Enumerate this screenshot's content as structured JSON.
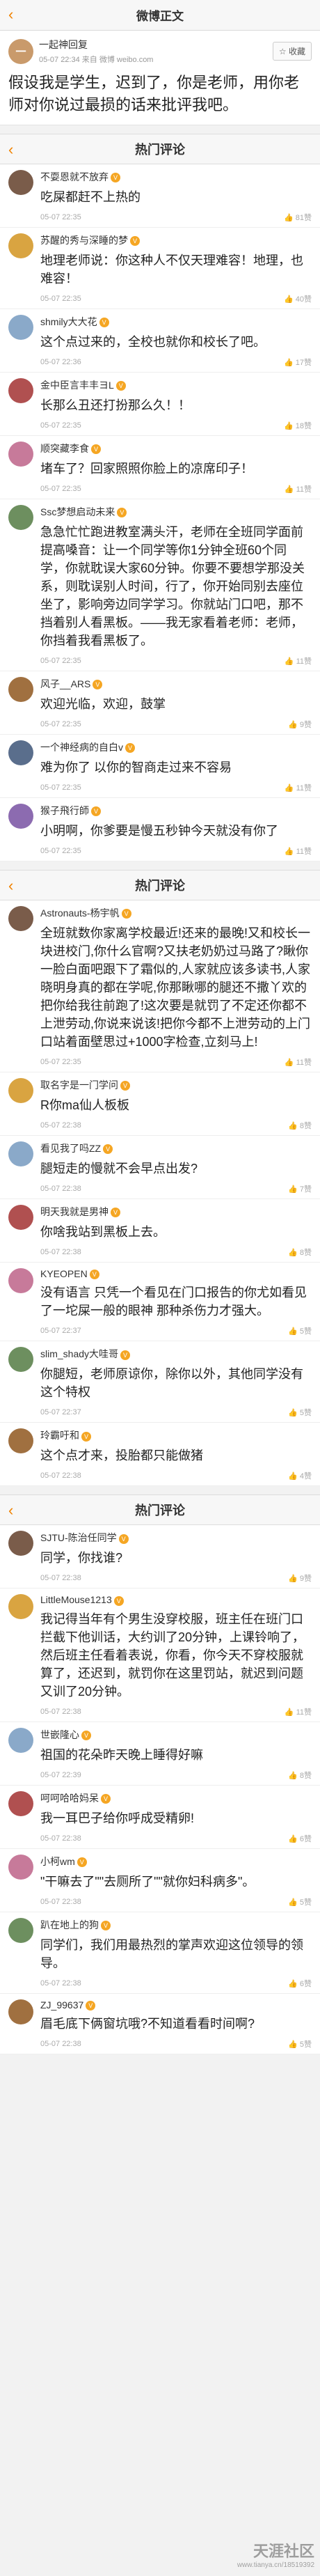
{
  "topbar": {
    "title": "微博正文",
    "back_icon": "chevron-left-icon"
  },
  "post": {
    "author": "一起神回复",
    "time": "05-07 22:34",
    "source": "来自 微博 weibo.com",
    "follow_label": "收藏",
    "text": "假设我是学生，迟到了，你是老师，用你老师对你说过最损的话来批评我吧。"
  },
  "sections": [
    {
      "title": "热门评论"
    },
    {
      "title": "热门评论"
    },
    {
      "title": "热门评论"
    }
  ],
  "comments_1": [
    {
      "name": "不耍恩就不放弃",
      "text": "吃屎都赶不上热的",
      "time": "05-07 22:35",
      "likes": "81赞"
    },
    {
      "name": "苏醒的秀与深睡的梦",
      "text": "地理老师说：你这种人不仅天理难容！地理，也难容！",
      "time": "05-07 22:35",
      "likes": "40赞"
    },
    {
      "name": "shmily大大花",
      "text": "这个点过来的，全校也就你和校长了吧。",
      "time": "05-07 22:36",
      "likes": "17赞"
    },
    {
      "name": "金中臣言丰丰ヨL",
      "text": "长那么丑还打扮那么久！！",
      "time": "05-07 22:35",
      "likes": "18赞"
    },
    {
      "name": "顺突藏李食",
      "text": "堵车了？回家照照你脸上的凉席印子！",
      "time": "05-07 22:35",
      "likes": "11赞"
    },
    {
      "name": "Ssc梦想启动未来",
      "text": "急急忙忙跑进教室满头汗，老师在全班同学面前提高嗓音：让一个同学等你1分钟全班60个同学，你就耽误大家60分钟。你要不要想学那没关系，则耽误别人时间，行了，你开始同别去座位坐了，影响旁边同学学习。你就站门口吧，那不挡着别人看黑板。——我无家看着老师：老师，你挡着我看黑板了。",
      "time": "05-07 22:35",
      "likes": "11赞"
    },
    {
      "name": "风子__ARS",
      "text": "欢迎光临，欢迎，鼓掌",
      "time": "05-07 22:35",
      "likes": "9赞"
    },
    {
      "name": "一个神经病的自白v",
      "text": "难为你了 以你的智商走过来不容易",
      "time": "05-07 22:35",
      "likes": "11赞"
    },
    {
      "name": "猴子飛行師",
      "text": "小明啊，你爹要是慢五秒钟今天就没有你了",
      "time": "05-07 22:35",
      "likes": "11赞"
    }
  ],
  "comments_2": [
    {
      "name": "Astronauts-杨宇帆",
      "text": "全班就数你家离学校最近!还来的最晚!又和校长一块进校门,你什么官啊?又扶老奶奶过马路了?瞅你一脸白面吧跟下了霜似的,人家就应该多读书,人家晓明身真的都在学呢,你那瞅哪的腿还不撒丫欢的把你给我往前跑了!这次要是就罚了不定还你都不上泄劳动,你说来说该!把你今都不上泄劳动的上门口站着面壁思过+1000字检查,立刻马上!",
      "time": "05-07 22:35",
      "likes": "11赞"
    },
    {
      "name": "取名字是一门学问",
      "text": "R你ma仙人板板",
      "time": "05-07 22:38",
      "likes": "8赞"
    },
    {
      "name": "看见我了吗ZZ",
      "text": "腿短走的慢就不会早点出发?",
      "time": "05-07 22:38",
      "likes": "7赞"
    },
    {
      "name": "明天我就是男神",
      "text": "你啥我站到黑板上去。",
      "time": "05-07 22:38",
      "likes": "8赞"
    },
    {
      "name": "KYEOPEN",
      "text": "没有语言 只凭一个看见在门口报告的你尤如看见了一坨屎一般的眼神 那种杀伤力才强大。",
      "time": "05-07 22:37",
      "likes": "5赞"
    },
    {
      "name": "slim_shady大哇哥",
      "text": "你腿短，老师原谅你，除你以外，其他同学没有这个特权",
      "time": "05-07 22:37",
      "likes": "5赞"
    },
    {
      "name": "玲霸吁和",
      "text": "这个点才来，投胎都只能做猪",
      "time": "05-07 22:38",
      "likes": "4赞"
    }
  ],
  "comments_3": [
    {
      "name": "SJTU-陈治任同学",
      "text": "同学，你找谁?",
      "time": "05-07 22:38",
      "likes": "9赞"
    },
    {
      "name": "LittleMouse1213",
      "text": "我记得当年有个男生没穿校服，班主任在班门口拦截下他训话，大约训了20分钟，上课铃响了，然后班主任看着表说，你看，你今天不穿校服就算了，还迟到，就罚你在这里罚站，就迟到问题又训了20分钟。",
      "time": "05-07 22:38",
      "likes": "11赞"
    },
    {
      "name": "世嵌隆心",
      "text": "祖国的花朵昨天晚上睡得好嘛",
      "time": "05-07 22:39",
      "likes": "8赞"
    },
    {
      "name": "呵呵哈哈妈呆",
      "text": "我一耳巴子给你呼成受精卵!",
      "time": "05-07 22:38",
      "likes": "6赞"
    },
    {
      "name": "小柯wm",
      "text": "\"干嘛去了\"\"去厕所了\"\"就你妇科病多\"。",
      "time": "05-07 22:38",
      "likes": "5赞"
    },
    {
      "name": "趴在地上的狗",
      "text": "同学们，我们用最热烈的掌声欢迎这位领导的领导。",
      "time": "05-07 22:38",
      "likes": "6赞"
    },
    {
      "name": "ZJ_99637",
      "text": "眉毛底下俩窗坑哦?不知道看看时间啊?",
      "time": "05-07 22:38",
      "likes": "5赞"
    }
  ],
  "watermark": {
    "big": "天涯社区",
    "small": "www.tianya.cn/18519392"
  },
  "accent_color": "#f08200",
  "name_color_vip": "#e86b0c"
}
